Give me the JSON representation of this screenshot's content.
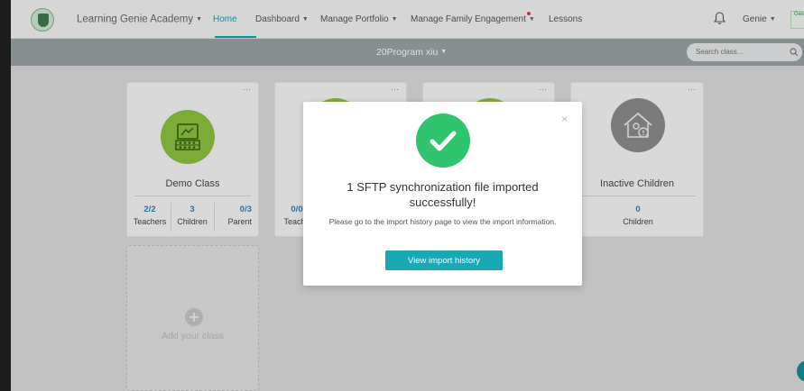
{
  "nav": {
    "brand": "Learning Genie Academy",
    "home": "Home",
    "dashboard": "Dashboard",
    "manage_portfolio": "Manage Portfolio",
    "manage_family_engagement": "Manage Family Engagement",
    "lessons": "Lessons",
    "user": "Genie",
    "logo2_text": "Genie"
  },
  "subheader": {
    "program": "20Program xiu",
    "search_placeholder": "Search class..."
  },
  "cards": [
    {
      "name": "Demo Class",
      "stats": [
        {
          "value": "2/2",
          "label": "Teachers"
        },
        {
          "value": "3",
          "label": "Children"
        },
        {
          "value": "0/3",
          "label": "Parent"
        }
      ]
    },
    {
      "stats": [
        {
          "value": "0/0",
          "label": "Teache"
        }
      ]
    },
    {},
    {
      "name": "Inactive Children",
      "stats": [
        {
          "value": "0",
          "label": "Children"
        }
      ]
    }
  ],
  "add_class": "Add your class",
  "modal": {
    "close": "×",
    "title": "1 SFTP synchronization file imported successfully!",
    "text": "Please go to the import history page to view the import information.",
    "button": "View import history"
  },
  "colors": {
    "accent": "#10a5b8",
    "green": "#2fc46d",
    "stat_blue": "#2e7fb8",
    "card_green": "#8bc43f",
    "inactive_grey": "#8c8c8c"
  }
}
